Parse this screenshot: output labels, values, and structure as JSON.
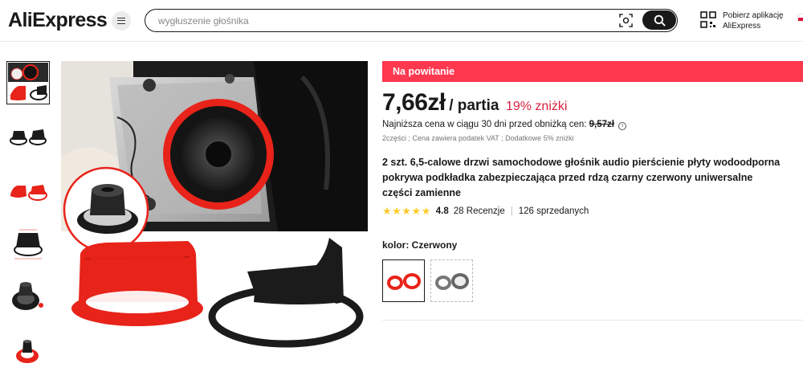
{
  "header": {
    "logo_text": "AliExpress",
    "search": {
      "value": "",
      "placeholder": "wygłuszenie głośnika"
    },
    "app_promo": {
      "line1": "Pobierz aplikację",
      "line2": "AliExpress"
    }
  },
  "gallery": {
    "thumbnail_count": 6,
    "selected_index": 0
  },
  "product": {
    "welcome_banner": "Na powitanie",
    "price": "7,66zł",
    "price_unit": "/ partia",
    "discount": "19% zniżki",
    "lowest_price_text": "Najniższa cena w ciągu 30 dni przed obniżką cen:",
    "lowest_price_value": "9,57zł",
    "vat_note": "2części ; Cena zawiera podatek VAT ; Dodatkowe 5% zniżki",
    "title": "2 szt. 6,5-calowe drzwi samochodowe głośnik audio pierścienie płyty wodoodporna pokrywa podkładka zabezpieczająca przed rdzą czarny czerwony uniwersalne części zamienne",
    "rating": {
      "stars": "★★★★★",
      "score": "4.8",
      "reviews": "28 Recenzje",
      "sold": "126 sprzedanych"
    },
    "color_label": "kolor: Czerwony",
    "variants": [
      "Czerwony",
      "Czarny"
    ],
    "selected_variant": "Czerwony"
  },
  "colors": {
    "accent": "#fd384f",
    "discount": "#d91f3c",
    "star": "#fccc2b",
    "ring_red": "#e8231a",
    "ring_black": "#1b1b1b"
  }
}
